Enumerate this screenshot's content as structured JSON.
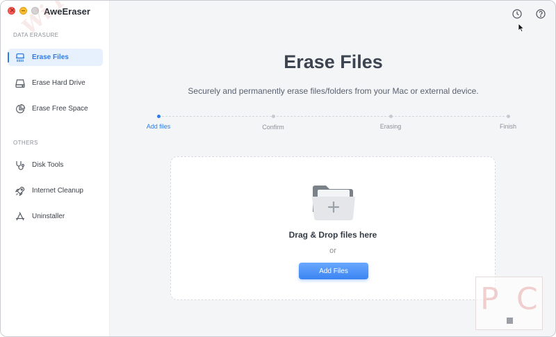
{
  "app": {
    "title": "AweEraser"
  },
  "sidebar": {
    "section_data": "DATA ERASURE",
    "section_others": "OTHERS",
    "items": [
      {
        "label": "Erase Files",
        "icon": "erase-files-icon",
        "active": true
      },
      {
        "label": "Erase Hard Drive",
        "icon": "hard-drive-icon",
        "active": false
      },
      {
        "label": "Erase Free Space",
        "icon": "pie-chart-icon",
        "active": false
      },
      {
        "label": "Disk Tools",
        "icon": "stethoscope-icon",
        "active": false
      },
      {
        "label": "Internet Cleanup",
        "icon": "rocket-icon",
        "active": false
      },
      {
        "label": "Uninstaller",
        "icon": "app-store-icon",
        "active": false
      }
    ],
    "watermark": "Wi PC"
  },
  "header": {
    "history_icon": "clock-icon",
    "help_icon": "help-icon"
  },
  "main": {
    "title": "Erase Files",
    "subtitle": "Securely and permanently erase files/folders from your Mac or external device.",
    "steps": [
      {
        "label": "Add files",
        "active": true
      },
      {
        "label": "Confirm",
        "active": false
      },
      {
        "label": "Erasing",
        "active": false
      },
      {
        "label": "Finish",
        "active": false
      }
    ],
    "dropzone": {
      "text": "Drag & Drop files here",
      "or": "or",
      "button": "Add Files"
    }
  },
  "badge": {
    "left": "P",
    "right": "C"
  },
  "colors": {
    "accent": "#2f7be5",
    "button": "#3a84f2",
    "active_bg": "#e7f1fd"
  }
}
